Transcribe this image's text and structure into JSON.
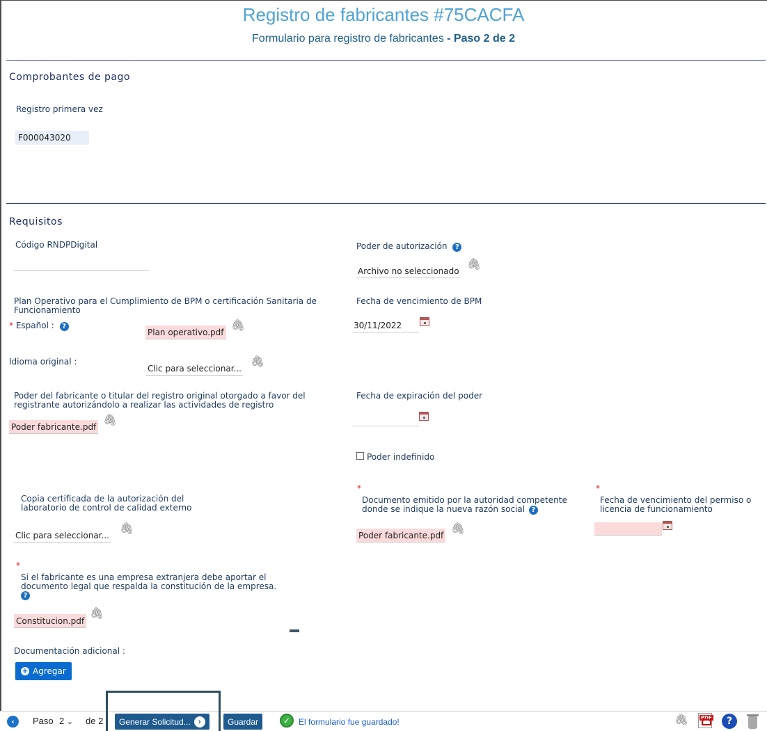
{
  "header": {
    "title": "Registro de fabricantes #75CACFA",
    "subtitle_main": "Formulario para registro de fabricantes",
    "subtitle_step": "- Paso 2 de 2"
  },
  "comprobantes": {
    "section_title": "Comprobantes de pago",
    "registro_label": "Registro primera vez",
    "registro_value": "F000043020"
  },
  "requisitos": {
    "section_title": "Requisitos",
    "codigo_label": "Código RNDPDigital",
    "codigo_value": "",
    "poder_autorizacion_label": "Poder de autorización",
    "poder_autorizacion_value": "Archivo no seleccionado",
    "plan_operativo_label": "Plan Operativo para el Cumplimiento de BPM o certificación Sanitaria de Funcionamiento",
    "espanol_label": "Español :",
    "espanol_file": "Plan operativo.pdf",
    "idioma_label": "Idioma original :",
    "idioma_file": "Clic para seleccionar...",
    "fecha_bpm_label": "Fecha de vencimiento de BPM",
    "fecha_bpm_value": "30/11/2022",
    "poder_fabricante_label": "Poder del fabricante o titular del registro original otorgado a favor del registrante autorizándolo a realizar las actividades de registro",
    "poder_fabricante_file": "Poder fabricante.pdf",
    "fecha_expiracion_label": "Fecha de expiración del poder",
    "fecha_expiracion_value": "",
    "poder_indefinido_label": "Poder indefinido",
    "copia_certificada_label": "Copia certificada de la autorización del laboratorio de control de calidad externo",
    "copia_certificada_file": "Clic para seleccionar...",
    "documento_emitido_label": "Documento emitido por la autoridad competente donde se indique la nueva razón social",
    "documento_emitido_file": "Poder fabricante.pdf",
    "fecha_permiso_label": "Fecha de vencimiento del permiso o licencia de funcionamiento",
    "fecha_permiso_value": "",
    "extranjera_label": "Si el fabricante es una empresa extranjera debe aportar el documento legal que respalda la constitución de la empresa.",
    "extranjera_file": "Constitucion.pdf",
    "doc_adicional_label": "Documentación adicional :",
    "agregar_label": "Agregar"
  },
  "bottombar": {
    "paso_label": "Paso",
    "paso_value": "2",
    "de_label": "de 2",
    "generar_label": "Generar Solicitud...",
    "guardar_label": "Guardar",
    "saved_message": "El formulario fue guardado!"
  },
  "icons": {
    "clip": "paperclip-icon",
    "help": "help-icon",
    "calendar": "calendar-icon",
    "pdf": "pdf-icon",
    "trash": "trash-icon"
  },
  "colors": {
    "title": "#4ea2d6",
    "section": "#1f2f6a",
    "file_highlight": "#fadada",
    "value_highlight": "#e9eff9",
    "primary_button": "#0a6cd0",
    "dark_button": "#1f5a8f",
    "success": "#3cb043"
  }
}
